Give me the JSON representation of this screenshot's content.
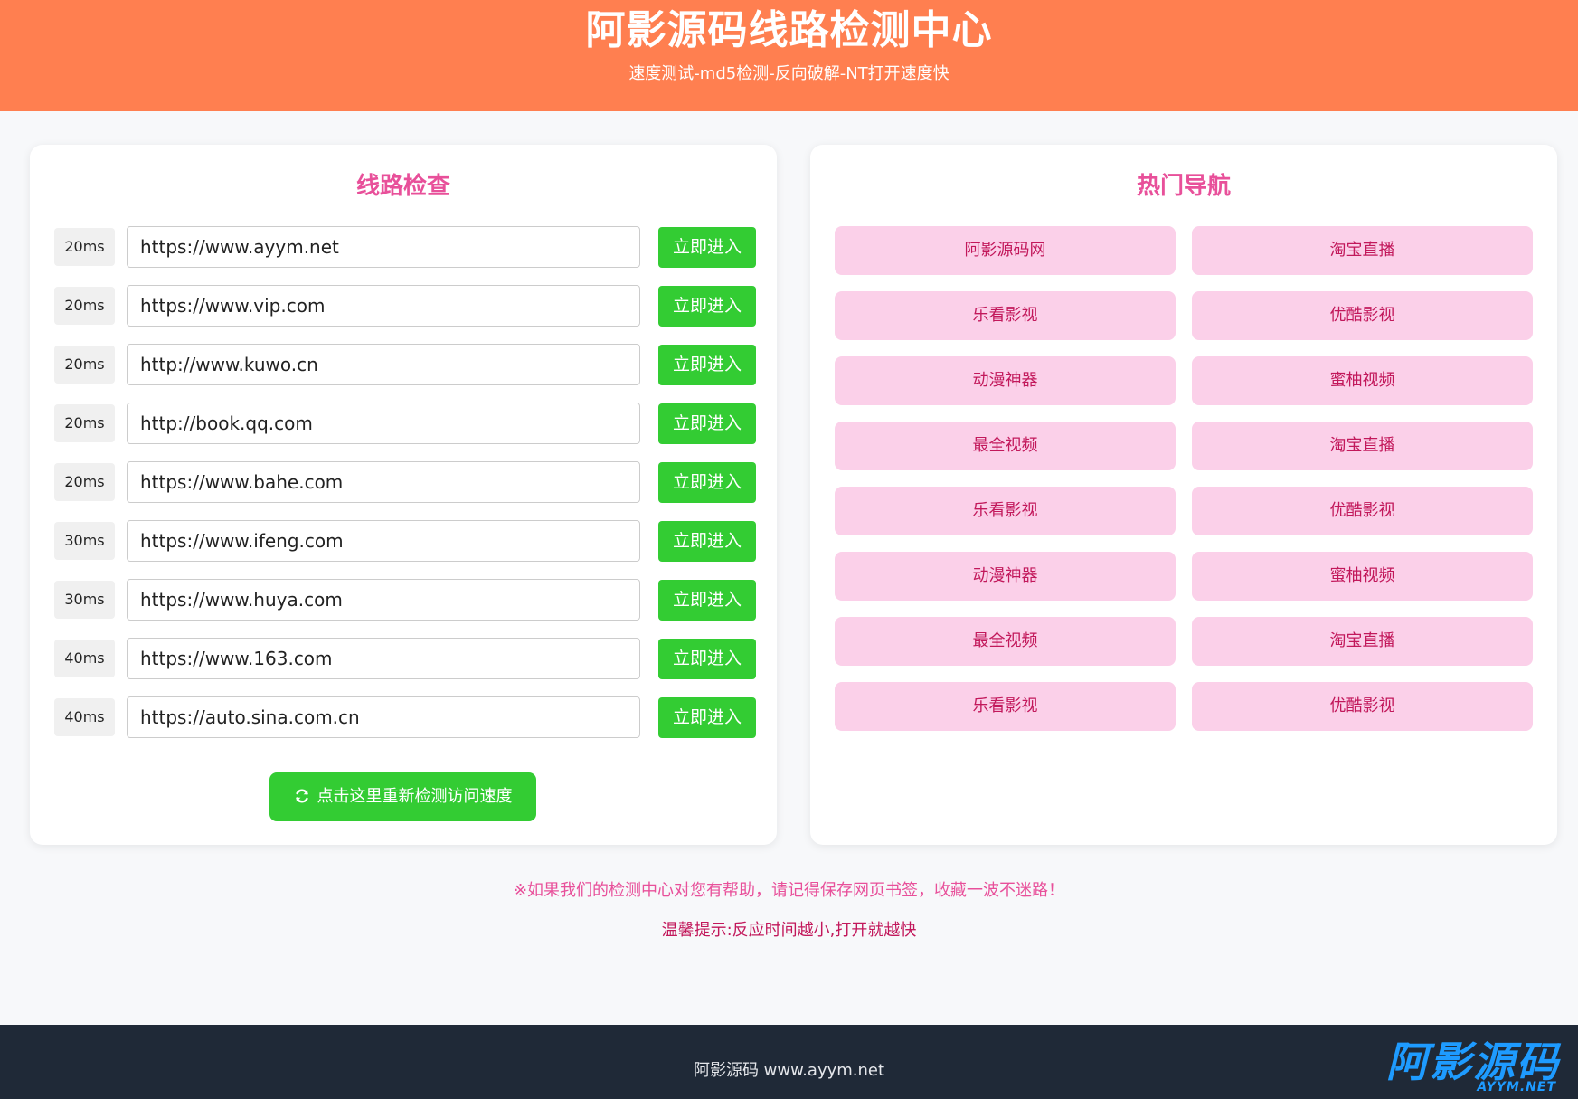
{
  "header": {
    "title": "阿影源码线路检测中心",
    "subtitle": "速度测试-md5检测-反向破解-NT打开速度快"
  },
  "lines": {
    "title": "线路检查",
    "enter_label": "立即进入",
    "items": [
      {
        "latency": "20ms",
        "url": "https://www.ayym.net"
      },
      {
        "latency": "20ms",
        "url": "https://www.vip.com"
      },
      {
        "latency": "20ms",
        "url": "http://www.kuwo.cn"
      },
      {
        "latency": "20ms",
        "url": "http://book.qq.com"
      },
      {
        "latency": "20ms",
        "url": "https://www.bahe.com"
      },
      {
        "latency": "30ms",
        "url": "https://www.ifeng.com"
      },
      {
        "latency": "30ms",
        "url": "https://www.huya.com"
      },
      {
        "latency": "40ms",
        "url": "https://www.163.com"
      },
      {
        "latency": "40ms",
        "url": "https://auto.sina.com.cn"
      }
    ],
    "recheck_label": "点击这里重新检测访问速度"
  },
  "nav": {
    "title": "热门导航",
    "items": [
      "阿影源码网",
      "淘宝直播",
      "乐看影视",
      "优酷影视",
      "动漫神器",
      "蜜柚视频",
      "最全视频",
      "淘宝直播",
      "乐看影视",
      "优酷影视",
      "动漫神器",
      "蜜柚视频",
      "最全视频",
      "淘宝直播",
      "乐看影视",
      "优酷影视"
    ]
  },
  "notes": {
    "bookmark": "※如果我们的检测中心对您有帮助，请记得保存网页书签，收藏一波不迷路！",
    "tip": "温馨提示:反应时间越小,打开就越快"
  },
  "footer": {
    "text": "阿影源码 www.ayym.net",
    "logo_main": "阿影源码",
    "logo_sub": "AYYM.NET"
  },
  "colors": {
    "header_bg": "#ff7f50",
    "accent_pink": "#e8509a",
    "button_green": "#33cc33",
    "nav_bg": "#fbd0e9",
    "footer_bg": "#1f2937",
    "logo_blue": "#1e9bff"
  }
}
